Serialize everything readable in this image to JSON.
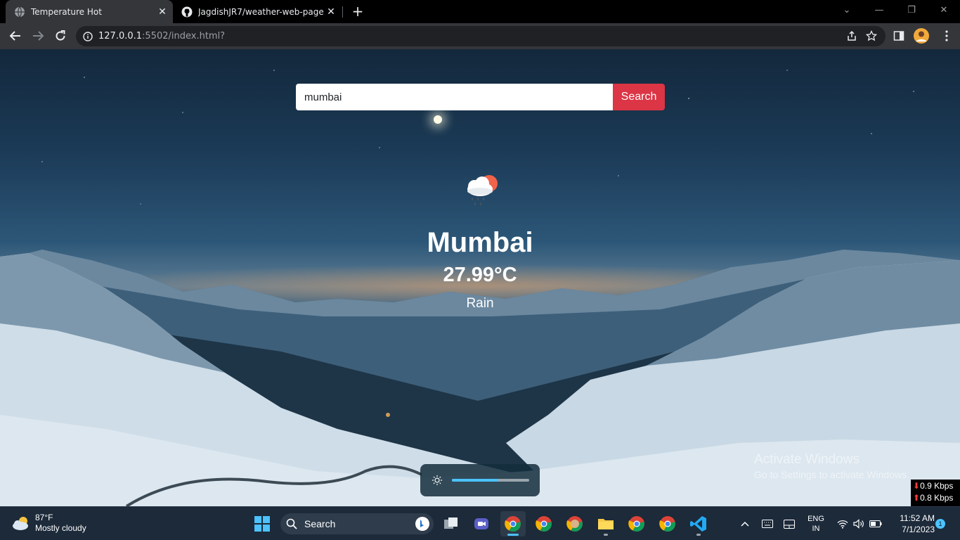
{
  "browser": {
    "tabs": [
      {
        "title": "Temperature Hot",
        "active": true,
        "favicon": "globe-icon"
      },
      {
        "title": "JagdishJR7/weather-web-page-",
        "active": false,
        "favicon": "github-icon"
      }
    ],
    "url_host": "127.0.0.1",
    "url_rest": ":5502/index.html?"
  },
  "page": {
    "search": {
      "value": "mumbai",
      "button_label": "Search"
    },
    "weather": {
      "city": "Mumbai",
      "temperature": "27.99°C",
      "condition": "Rain",
      "icon": "rain-cloud-sun-icon"
    },
    "brightness_level": 0.6,
    "activate_windows": {
      "line1": "Activate Windows",
      "line2": "Go to Settings to activate Windows."
    },
    "net_speed": {
      "down": "0.9 Kbps",
      "up": "0.8 Kbps"
    }
  },
  "taskbar": {
    "weather_temp": "87°F",
    "weather_desc": "Mostly cloudy",
    "search_label": "Search",
    "lang_line1": "ENG",
    "lang_line2": "IN",
    "time": "11:52 AM",
    "date": "7/1/2023",
    "notifications": "1"
  },
  "colors": {
    "accent": "#dc3545",
    "taskbar_accent": "#4cc2ff"
  }
}
